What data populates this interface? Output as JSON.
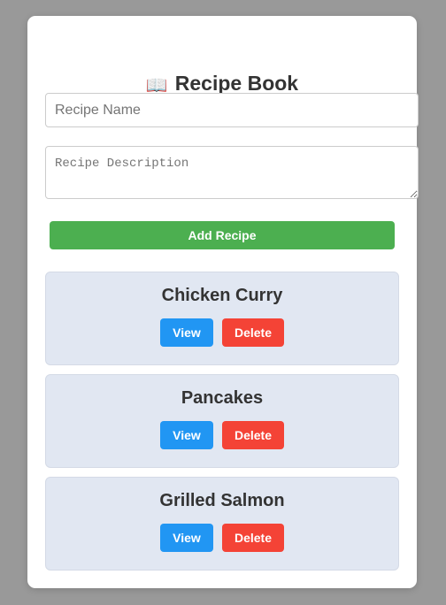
{
  "header": {
    "icon": "📖",
    "title": "Recipe Book"
  },
  "form": {
    "name_placeholder": "Recipe Name",
    "name_value": "",
    "description_placeholder": "Recipe Description",
    "description_value": "",
    "add_label": "Add Recipe"
  },
  "recipes": [
    {
      "name": "Chicken Curry",
      "view_label": "View",
      "delete_label": "Delete"
    },
    {
      "name": "Pancakes",
      "view_label": "View",
      "delete_label": "Delete"
    },
    {
      "name": "Grilled Salmon",
      "view_label": "View",
      "delete_label": "Delete"
    }
  ],
  "colors": {
    "page_background": "#999999",
    "card_background": "#ffffff",
    "add_button": "#4caf50",
    "view_button": "#2196f3",
    "delete_button": "#f44336",
    "recipe_background": "#e1e7f2",
    "title_text": "#333333"
  }
}
